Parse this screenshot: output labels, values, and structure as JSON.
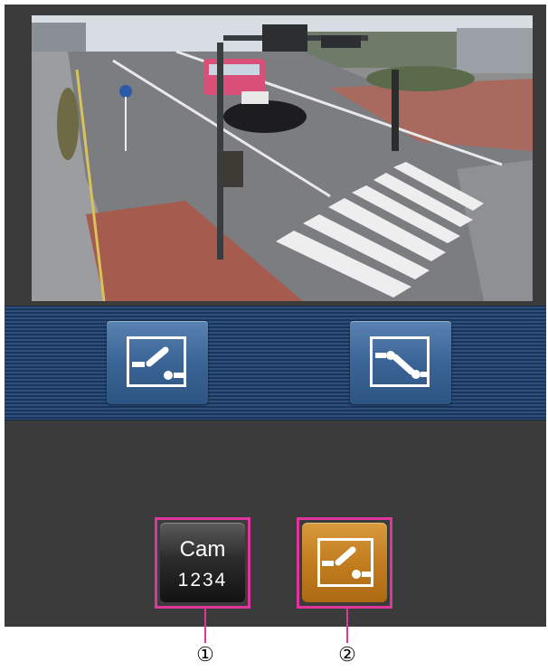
{
  "camera_view": {
    "description_icon": "live-camera-image"
  },
  "toolbar": {
    "left_button_icon": "preset-switch-left-icon",
    "right_button_icon": "preset-switch-right-icon"
  },
  "bottom_bar": {
    "cam_button": {
      "line1": "Cam",
      "line2": "1234"
    },
    "favorite_button_icon": "preset-favorite-icon"
  },
  "callouts": {
    "marker_1": "①",
    "marker_2": "②"
  },
  "colors": {
    "accent_callout": "#e0359b",
    "toolbar_blue": "#2c4f7d",
    "active_orange": "#c27d1f"
  }
}
